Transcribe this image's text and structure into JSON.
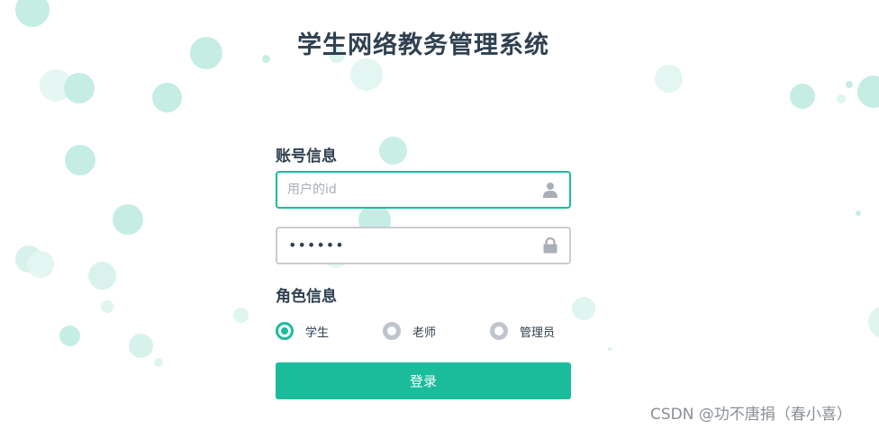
{
  "header": {
    "title": "学生网络教务管理系统"
  },
  "account": {
    "section_label": "账号信息",
    "username_placeholder": "用户的id",
    "username_value": "",
    "username_icon": "user-icon",
    "password_value": "••••••",
    "password_icon": "lock-icon"
  },
  "role": {
    "section_label": "角色信息",
    "options": [
      {
        "label": "学生",
        "checked": true
      },
      {
        "label": "老师",
        "checked": false
      },
      {
        "label": "管理员",
        "checked": false
      }
    ]
  },
  "actions": {
    "login_label": "登录"
  },
  "watermark": {
    "text": "CSDN @功不唐捐（春小喜）"
  },
  "colors": {
    "accent": "#1abc9c",
    "title": "#2f4050",
    "bubble": "#c5ede4",
    "radio_unchecked": "#c0c4cc"
  }
}
